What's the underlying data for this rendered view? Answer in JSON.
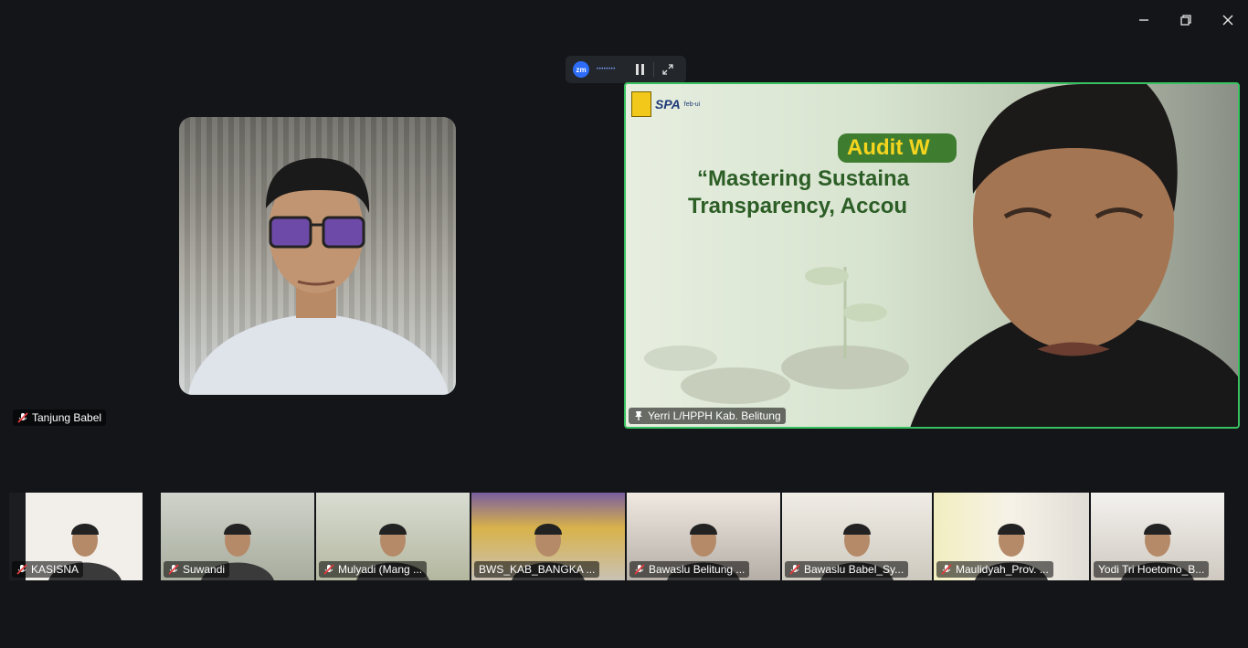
{
  "window": {
    "controls": {
      "minimize": "minimize-icon",
      "restore": "restore-icon",
      "close": "close-icon"
    }
  },
  "recording": {
    "logo": "zm",
    "status": "••••••••",
    "pause_icon": "pause-icon",
    "expand_icon": "expand-icon",
    "accent": "#2d6cf6"
  },
  "main_tiles": [
    {
      "name": "Tanjung Babel",
      "muted": true
    },
    {
      "name": "Yerri L/HPPH Kab. Belitung",
      "muted": false,
      "active_speaker": true,
      "speaker_border": "#37c15f"
    }
  ],
  "shared_slide": {
    "logo_text": "SPA",
    "logo_sub": "feb-ui",
    "pill": "Audit W",
    "line1": "“Mastering Sustaina",
    "line2": "Transparency, Accou"
  },
  "strip_tiles": [
    {
      "name": "KASISNA",
      "muted": true
    },
    {
      "name": "Suwandi",
      "muted": true
    },
    {
      "name": "Mulyadi (Mang ...",
      "muted": true
    },
    {
      "name": "BWS_KAB_BANGKA ...",
      "muted": false
    },
    {
      "name": "Bawaslu Belitung ...",
      "muted": true
    },
    {
      "name": "Bawaslu Babel_Sy...",
      "muted": true
    },
    {
      "name": "Maulidyah_Prov. ...",
      "muted": true
    },
    {
      "name": "Yodi Tri Hoetomo_B...",
      "muted": false
    }
  ]
}
